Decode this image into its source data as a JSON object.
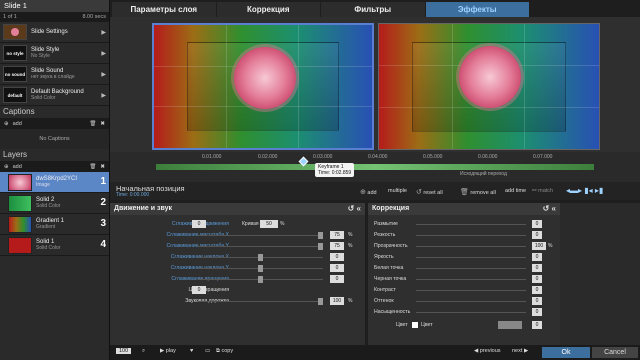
{
  "slide": {
    "title": "Slide 1",
    "counter": "1 of 1",
    "duration": "8.00 secs"
  },
  "slide_items": [
    {
      "thumb": "",
      "title": "Slide Settings",
      "sub": ""
    },
    {
      "thumb": "no style",
      "title": "Slide Style",
      "sub": "No Style"
    },
    {
      "thumb": "no sound",
      "title": "Slide Sound",
      "sub": "нет звука в слайде"
    },
    {
      "thumb": "default",
      "title": "Default Background",
      "sub": "Solid Color"
    }
  ],
  "captions": {
    "title": "Captions",
    "add": "add",
    "empty": "No Captions"
  },
  "layers": {
    "title": "Layers",
    "add": "add",
    "items": [
      {
        "name": "dwS8Krpd2YCI",
        "sub": "Image",
        "num": "1"
      },
      {
        "name": "Solid 2",
        "sub": "Solid Color",
        "num": "2"
      },
      {
        "name": "Gradient 1",
        "sub": "Gradient",
        "num": "3"
      },
      {
        "name": "Solid 1",
        "sub": "Solid Color",
        "num": "4"
      }
    ]
  },
  "tabs": [
    "Параметры слоя",
    "Коррекция",
    "Фильтры",
    "Эффекты"
  ],
  "timeline": {
    "ticks": [
      "0.01.000",
      "0.02.000",
      "0.03.000",
      "0.04.000",
      "0.05.000",
      "0.06.000",
      "0.07.000"
    ],
    "kf_title": "Keyframe 1",
    "kf_time": "Time: 0:02.859",
    "end_label": "Исходящий переход"
  },
  "position": {
    "label": "Начальная позиция",
    "time": "Time: 0:00.000"
  },
  "toolbar": {
    "add": "add",
    "multiple": "multiple",
    "reset_all": "reset all",
    "remove_all": "remove all",
    "add_time": "add time",
    "match": "match"
  },
  "motion": {
    "title": "Движение и звук",
    "rows": [
      {
        "label": "Сглаживание движения",
        "val": "0",
        "extra": "Кривая",
        "extra_val": "50",
        "pct": "%"
      },
      {
        "label": "Сглаживание масштаба X",
        "val": "75",
        "pct": "%"
      },
      {
        "label": "Сглаживание масштаба Y",
        "val": "75",
        "pct": "%"
      },
      {
        "label": "Сглаживание наклона X",
        "val": "0",
        "pct": ""
      },
      {
        "label": "Сглаживание наклона Y",
        "val": "0",
        "pct": ""
      },
      {
        "label": "Сглаживание вращения",
        "val": "0",
        "pct": ""
      },
      {
        "label": "Центр вращения",
        "val": "0",
        "pct": ""
      },
      {
        "label": "Звуковая дорожка",
        "val": "100",
        "pct": "%"
      }
    ]
  },
  "correction": {
    "title": "Коррекция",
    "rows": [
      {
        "label": "Размытие",
        "val": "0"
      },
      {
        "label": "Резкость",
        "val": "0"
      },
      {
        "label": "Прозрачность",
        "val": "100",
        "pct": "%"
      },
      {
        "label": "Яркость",
        "val": "0"
      },
      {
        "label": "Белая точка",
        "val": "0"
      },
      {
        "label": "Черная точка",
        "val": "0"
      },
      {
        "label": "Контраст",
        "val": "0"
      },
      {
        "label": "Оттенок",
        "val": "0"
      },
      {
        "label": "Насыщенность",
        "val": "0"
      }
    ],
    "color_label": "Цвет",
    "color_check": "Цвет",
    "color_val": "0"
  },
  "bottom": {
    "zoom": "100",
    "play": "play",
    "copy": "copy",
    "previous": "previous",
    "next": "next",
    "ok": "Ok",
    "cancel": "Cancel"
  },
  "colors": {
    "accent": "#3d6f9e",
    "selected_layer": "#5b87c7"
  }
}
